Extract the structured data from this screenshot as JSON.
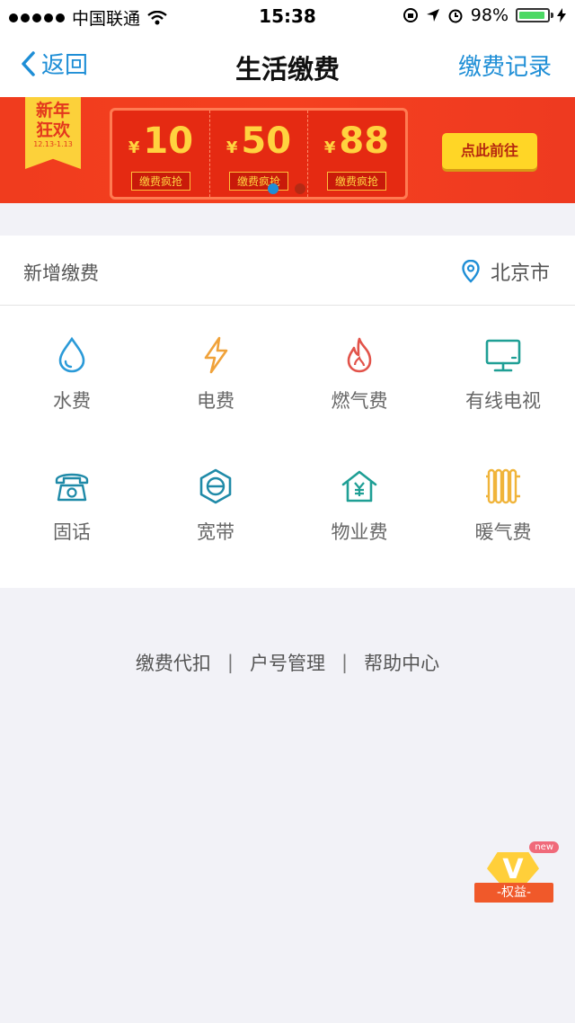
{
  "status_bar": {
    "carrier": "中国联通",
    "time": "15:38",
    "battery": "98%"
  },
  "nav": {
    "back_label": "返回",
    "title": "生活缴费",
    "right_label": "缴费记录"
  },
  "banner": {
    "ribbon_line1": "新年",
    "ribbon_line2": "狂欢",
    "ribbon_date": "12.13-1.13",
    "currency": "¥",
    "coupons": [
      {
        "amount": "10",
        "label": "缴费疯抢"
      },
      {
        "amount": "50",
        "label": "缴费疯抢"
      },
      {
        "amount": "88",
        "label": "缴费疯抢"
      }
    ],
    "button": "点此前往"
  },
  "section": {
    "title": "新增缴费",
    "location": "北京市"
  },
  "services": [
    {
      "label": "水费",
      "icon": "water-drop-icon"
    },
    {
      "label": "电费",
      "icon": "lightning-icon"
    },
    {
      "label": "燃气费",
      "icon": "flame-icon"
    },
    {
      "label": "有线电视",
      "icon": "tv-icon"
    },
    {
      "label": "固话",
      "icon": "telephone-icon"
    },
    {
      "label": "宽带",
      "icon": "broadband-icon"
    },
    {
      "label": "物业费",
      "icon": "house-yen-icon"
    },
    {
      "label": "暖气费",
      "icon": "radiator-icon"
    }
  ],
  "footer_links": [
    "缴费代扣",
    "户号管理",
    "帮助中心"
  ],
  "footer_separator": "|",
  "float_badge": {
    "new": "new",
    "letter": "V",
    "label": "-权益-"
  },
  "colors": {
    "accent": "#1e8ed6",
    "banner_red": "#f03c1e",
    "gold": "#ffd33f"
  }
}
